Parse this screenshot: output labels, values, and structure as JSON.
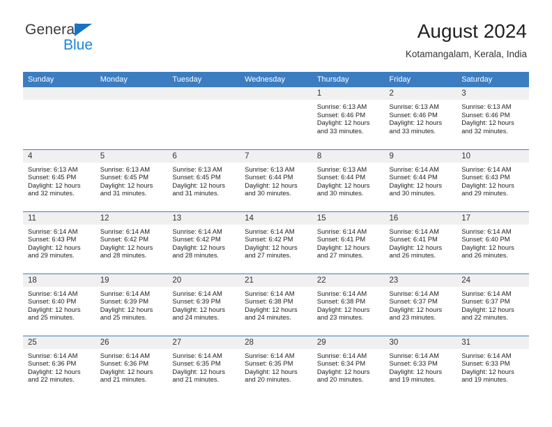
{
  "brand": {
    "name_part1": "General",
    "name_part2": "Blue",
    "triangle_icon": "blue-triangle-logo-mark",
    "colors": {
      "dark": "#3b3b3b",
      "blue": "#1b84d8",
      "triangle": "#1773c4"
    }
  },
  "header": {
    "title": "August 2024",
    "location": "Kotamangalam, Kerala, India"
  },
  "theme": {
    "header_row_bg": "#3c7dc1",
    "header_row_text": "#ffffff",
    "daynum_bg": "#f0f0f0",
    "row_divider": "#3c7dc1",
    "body_text": "#222222"
  },
  "weekdays": [
    "Sunday",
    "Monday",
    "Tuesday",
    "Wednesday",
    "Thursday",
    "Friday",
    "Saturday"
  ],
  "weeks": [
    [
      {
        "day": "",
        "empty": true
      },
      {
        "day": "",
        "empty": true
      },
      {
        "day": "",
        "empty": true
      },
      {
        "day": "",
        "empty": true
      },
      {
        "day": "1",
        "sunrise": "Sunrise: 6:13 AM",
        "sunset": "Sunset: 6:46 PM",
        "daylight1": "Daylight: 12 hours",
        "daylight2": "and 33 minutes."
      },
      {
        "day": "2",
        "sunrise": "Sunrise: 6:13 AM",
        "sunset": "Sunset: 6:46 PM",
        "daylight1": "Daylight: 12 hours",
        "daylight2": "and 33 minutes."
      },
      {
        "day": "3",
        "sunrise": "Sunrise: 6:13 AM",
        "sunset": "Sunset: 6:46 PM",
        "daylight1": "Daylight: 12 hours",
        "daylight2": "and 32 minutes."
      }
    ],
    [
      {
        "day": "4",
        "sunrise": "Sunrise: 6:13 AM",
        "sunset": "Sunset: 6:45 PM",
        "daylight1": "Daylight: 12 hours",
        "daylight2": "and 32 minutes."
      },
      {
        "day": "5",
        "sunrise": "Sunrise: 6:13 AM",
        "sunset": "Sunset: 6:45 PM",
        "daylight1": "Daylight: 12 hours",
        "daylight2": "and 31 minutes."
      },
      {
        "day": "6",
        "sunrise": "Sunrise: 6:13 AM",
        "sunset": "Sunset: 6:45 PM",
        "daylight1": "Daylight: 12 hours",
        "daylight2": "and 31 minutes."
      },
      {
        "day": "7",
        "sunrise": "Sunrise: 6:13 AM",
        "sunset": "Sunset: 6:44 PM",
        "daylight1": "Daylight: 12 hours",
        "daylight2": "and 30 minutes."
      },
      {
        "day": "8",
        "sunrise": "Sunrise: 6:13 AM",
        "sunset": "Sunset: 6:44 PM",
        "daylight1": "Daylight: 12 hours",
        "daylight2": "and 30 minutes."
      },
      {
        "day": "9",
        "sunrise": "Sunrise: 6:14 AM",
        "sunset": "Sunset: 6:44 PM",
        "daylight1": "Daylight: 12 hours",
        "daylight2": "and 30 minutes."
      },
      {
        "day": "10",
        "sunrise": "Sunrise: 6:14 AM",
        "sunset": "Sunset: 6:43 PM",
        "daylight1": "Daylight: 12 hours",
        "daylight2": "and 29 minutes."
      }
    ],
    [
      {
        "day": "11",
        "sunrise": "Sunrise: 6:14 AM",
        "sunset": "Sunset: 6:43 PM",
        "daylight1": "Daylight: 12 hours",
        "daylight2": "and 29 minutes."
      },
      {
        "day": "12",
        "sunrise": "Sunrise: 6:14 AM",
        "sunset": "Sunset: 6:42 PM",
        "daylight1": "Daylight: 12 hours",
        "daylight2": "and 28 minutes."
      },
      {
        "day": "13",
        "sunrise": "Sunrise: 6:14 AM",
        "sunset": "Sunset: 6:42 PM",
        "daylight1": "Daylight: 12 hours",
        "daylight2": "and 28 minutes."
      },
      {
        "day": "14",
        "sunrise": "Sunrise: 6:14 AM",
        "sunset": "Sunset: 6:42 PM",
        "daylight1": "Daylight: 12 hours",
        "daylight2": "and 27 minutes."
      },
      {
        "day": "15",
        "sunrise": "Sunrise: 6:14 AM",
        "sunset": "Sunset: 6:41 PM",
        "daylight1": "Daylight: 12 hours",
        "daylight2": "and 27 minutes."
      },
      {
        "day": "16",
        "sunrise": "Sunrise: 6:14 AM",
        "sunset": "Sunset: 6:41 PM",
        "daylight1": "Daylight: 12 hours",
        "daylight2": "and 26 minutes."
      },
      {
        "day": "17",
        "sunrise": "Sunrise: 6:14 AM",
        "sunset": "Sunset: 6:40 PM",
        "daylight1": "Daylight: 12 hours",
        "daylight2": "and 26 minutes."
      }
    ],
    [
      {
        "day": "18",
        "sunrise": "Sunrise: 6:14 AM",
        "sunset": "Sunset: 6:40 PM",
        "daylight1": "Daylight: 12 hours",
        "daylight2": "and 25 minutes."
      },
      {
        "day": "19",
        "sunrise": "Sunrise: 6:14 AM",
        "sunset": "Sunset: 6:39 PM",
        "daylight1": "Daylight: 12 hours",
        "daylight2": "and 25 minutes."
      },
      {
        "day": "20",
        "sunrise": "Sunrise: 6:14 AM",
        "sunset": "Sunset: 6:39 PM",
        "daylight1": "Daylight: 12 hours",
        "daylight2": "and 24 minutes."
      },
      {
        "day": "21",
        "sunrise": "Sunrise: 6:14 AM",
        "sunset": "Sunset: 6:38 PM",
        "daylight1": "Daylight: 12 hours",
        "daylight2": "and 24 minutes."
      },
      {
        "day": "22",
        "sunrise": "Sunrise: 6:14 AM",
        "sunset": "Sunset: 6:38 PM",
        "daylight1": "Daylight: 12 hours",
        "daylight2": "and 23 minutes."
      },
      {
        "day": "23",
        "sunrise": "Sunrise: 6:14 AM",
        "sunset": "Sunset: 6:37 PM",
        "daylight1": "Daylight: 12 hours",
        "daylight2": "and 23 minutes."
      },
      {
        "day": "24",
        "sunrise": "Sunrise: 6:14 AM",
        "sunset": "Sunset: 6:37 PM",
        "daylight1": "Daylight: 12 hours",
        "daylight2": "and 22 minutes."
      }
    ],
    [
      {
        "day": "25",
        "sunrise": "Sunrise: 6:14 AM",
        "sunset": "Sunset: 6:36 PM",
        "daylight1": "Daylight: 12 hours",
        "daylight2": "and 22 minutes."
      },
      {
        "day": "26",
        "sunrise": "Sunrise: 6:14 AM",
        "sunset": "Sunset: 6:36 PM",
        "daylight1": "Daylight: 12 hours",
        "daylight2": "and 21 minutes."
      },
      {
        "day": "27",
        "sunrise": "Sunrise: 6:14 AM",
        "sunset": "Sunset: 6:35 PM",
        "daylight1": "Daylight: 12 hours",
        "daylight2": "and 21 minutes."
      },
      {
        "day": "28",
        "sunrise": "Sunrise: 6:14 AM",
        "sunset": "Sunset: 6:35 PM",
        "daylight1": "Daylight: 12 hours",
        "daylight2": "and 20 minutes."
      },
      {
        "day": "29",
        "sunrise": "Sunrise: 6:14 AM",
        "sunset": "Sunset: 6:34 PM",
        "daylight1": "Daylight: 12 hours",
        "daylight2": "and 20 minutes."
      },
      {
        "day": "30",
        "sunrise": "Sunrise: 6:14 AM",
        "sunset": "Sunset: 6:33 PM",
        "daylight1": "Daylight: 12 hours",
        "daylight2": "and 19 minutes."
      },
      {
        "day": "31",
        "sunrise": "Sunrise: 6:14 AM",
        "sunset": "Sunset: 6:33 PM",
        "daylight1": "Daylight: 12 hours",
        "daylight2": "and 19 minutes."
      }
    ]
  ]
}
